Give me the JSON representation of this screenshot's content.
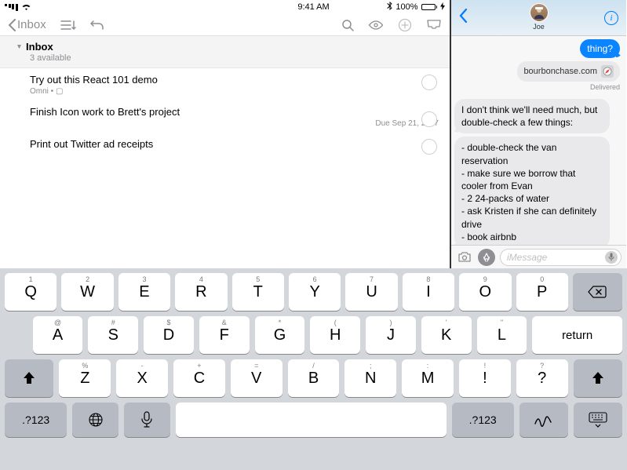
{
  "status_bar": {
    "time": "9:41 AM",
    "battery_pct": "100%",
    "carrier_icons": true
  },
  "toolbar": {
    "back_label": "Inbox"
  },
  "section": {
    "title": "Inbox",
    "subtitle": "3 available"
  },
  "todos": [
    {
      "title": "Try out this React 101 demo",
      "meta": "Omni • ▢",
      "due": ""
    },
    {
      "title": "Finish Icon work to Brett's project",
      "meta": "",
      "due": "Due Sep 21, 2017"
    },
    {
      "title": "Print out Twitter ad receipts",
      "meta": "",
      "due": ""
    }
  ],
  "messages": {
    "contact_name": "Joe",
    "out_bubble": "thing?",
    "link_text": "bourbonchase.com",
    "delivered_label": "Delivered",
    "in_bubble_1": "I don't think we'll need much, but double-check a few things:",
    "in_bubble_2": "- double-check the van reservation\n- make sure we borrow that cooler from Evan\n- 2 24-packs of water\n- ask Kristen if she can definitely drive\n- book airbnb",
    "input_placeholder": "iMessage"
  },
  "keyboard": {
    "row1": [
      {
        "m": "Q",
        "a": "1"
      },
      {
        "m": "W",
        "a": "2"
      },
      {
        "m": "E",
        "a": "3"
      },
      {
        "m": "R",
        "a": "4"
      },
      {
        "m": "T",
        "a": "5"
      },
      {
        "m": "Y",
        "a": "6"
      },
      {
        "m": "U",
        "a": "7"
      },
      {
        "m": "I",
        "a": "8"
      },
      {
        "m": "O",
        "a": "9"
      },
      {
        "m": "P",
        "a": "0"
      }
    ],
    "row2": [
      {
        "m": "A",
        "a": "@"
      },
      {
        "m": "S",
        "a": "#"
      },
      {
        "m": "D",
        "a": "$"
      },
      {
        "m": "F",
        "a": "&"
      },
      {
        "m": "G",
        "a": "*"
      },
      {
        "m": "H",
        "a": "("
      },
      {
        "m": "J",
        "a": ")"
      },
      {
        "m": "K",
        "a": "'"
      },
      {
        "m": "L",
        "a": "\""
      }
    ],
    "row3": [
      {
        "m": "Z",
        "a": "%"
      },
      {
        "m": "X",
        "a": "-"
      },
      {
        "m": "C",
        "a": "+"
      },
      {
        "m": "V",
        "a": "="
      },
      {
        "m": "B",
        "a": "/"
      },
      {
        "m": "N",
        "a": ";"
      },
      {
        "m": "M",
        "a": ":"
      },
      {
        "m": "!",
        "a": "!"
      },
      {
        "m": "?",
        "a": "?"
      }
    ],
    "return_label": "return",
    "sym_label": ".?123"
  }
}
